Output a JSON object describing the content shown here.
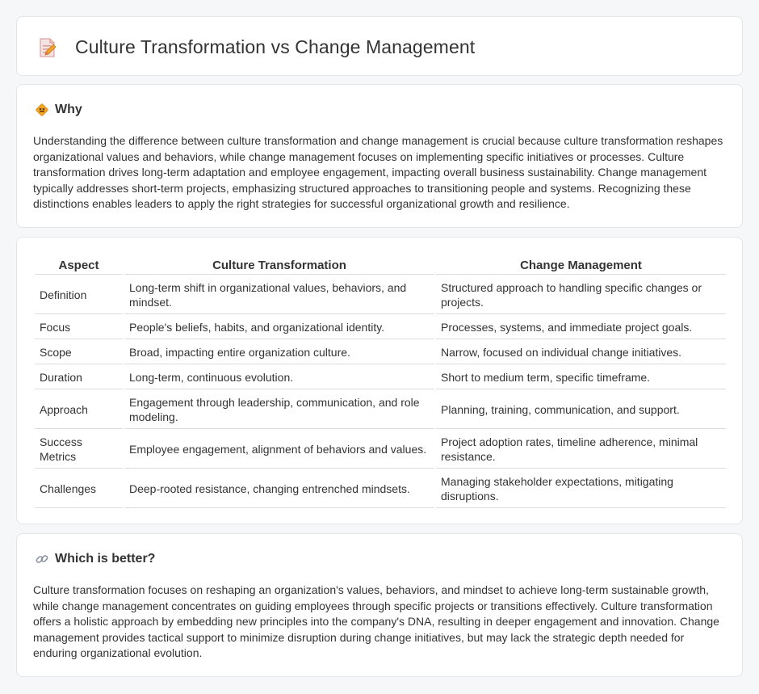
{
  "header": {
    "title": "Culture Transformation vs Change Management",
    "icon": "document-pencil-icon"
  },
  "why": {
    "heading": "Why",
    "icon": "diamond-sign-icon",
    "text": "Understanding the difference between culture transformation and change management is crucial because culture transformation reshapes organizational values and behaviors, while change management focuses on implementing specific initiatives or processes. Culture transformation drives long-term adaptation and employee engagement, impacting overall business sustainability. Change management typically addresses short-term projects, emphasizing structured approaches to transitioning people and systems. Recognizing these distinctions enables leaders to apply the right strategies for successful organizational growth and resilience."
  },
  "table": {
    "headers": [
      "Aspect",
      "Culture Transformation",
      "Change Management"
    ],
    "rows": [
      {
        "aspect": "Definition",
        "culture": "Long-term shift in organizational values, behaviors, and mindset.",
        "change": "Structured approach to handling specific changes or projects."
      },
      {
        "aspect": "Focus",
        "culture": "People's beliefs, habits, and organizational identity.",
        "change": "Processes, systems, and immediate project goals."
      },
      {
        "aspect": "Scope",
        "culture": "Broad, impacting entire organization culture.",
        "change": "Narrow, focused on individual change initiatives."
      },
      {
        "aspect": "Duration",
        "culture": "Long-term, continuous evolution.",
        "change": "Short to medium term, specific timeframe."
      },
      {
        "aspect": "Approach",
        "culture": "Engagement through leadership, communication, and role modeling.",
        "change": "Planning, training, communication, and support."
      },
      {
        "aspect": "Success Metrics",
        "culture": "Employee engagement, alignment of behaviors and values.",
        "change": "Project adoption rates, timeline adherence, minimal resistance."
      },
      {
        "aspect": "Challenges",
        "culture": "Deep-rooted resistance, changing entrenched mindsets.",
        "change": "Managing stakeholder expectations, mitigating disruptions."
      }
    ]
  },
  "better": {
    "heading": "Which is better?",
    "icon": "link-icon",
    "text": "Culture transformation focuses on reshaping an organization's values, behaviors, and mindset to achieve long-term sustainable growth, while change management concentrates on guiding employees through specific projects or transitions effectively. Culture transformation offers a holistic approach by embedding new principles into the company's DNA, resulting in deeper engagement and innovation. Change management provides tactical support to minimize disruption during change initiatives, but may lack the strategic depth needed for enduring organizational evolution."
  }
}
